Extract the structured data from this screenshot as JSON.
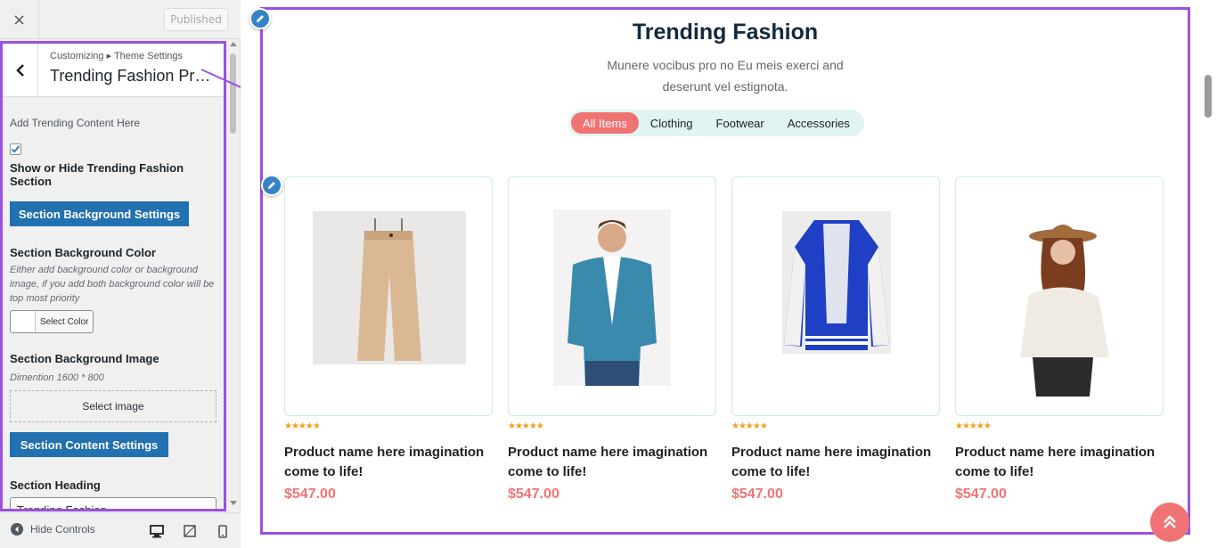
{
  "topbar": {
    "close_icon": "×",
    "publish_label": "Published"
  },
  "panel": {
    "breadcrumb": "Customizing ▸ Theme Settings",
    "title": "Trending Fashion Pro…",
    "add_content_text": "Add Trending Content Here",
    "show_hide_label": "Show or Hide Trending Fashion Section",
    "show_hide_checked": true,
    "bg_settings_button": "Section Background Settings",
    "bg_color_label": "Section Background Color",
    "bg_color_desc": "Either add background color or background image, if you add both background color will be top most priority",
    "select_color_label": "Select Color",
    "bg_image_label": "Section Background Image",
    "bg_image_desc": "Dimention 1600 * 800",
    "select_image_label": "Select image",
    "content_settings_button": "Section Content Settings",
    "heading_label": "Section Heading",
    "heading_value": "Trending Fashion"
  },
  "footer": {
    "hide_controls_label": "Hide Controls"
  },
  "preview": {
    "title": "Trending Fashion",
    "description": "Munere vocibus pro no Eu meis exerci and deserunt vel estignota.",
    "filters": [
      "All Items",
      "Clothing",
      "Footwear",
      "Accessories"
    ],
    "active_filter": "All Items",
    "products": [
      {
        "image": "beige-trousers",
        "name": "Product name here imagination come to life!",
        "price": "$547.00",
        "rating": 5
      },
      {
        "image": "man-denim-shirt",
        "name": "Product name here imagination come to life!",
        "price": "$547.00",
        "rating": 5
      },
      {
        "image": "blue-varsity-jacket",
        "name": "Product name here imagination come to life!",
        "price": "$547.00",
        "rating": 5
      },
      {
        "image": "woman-hat-sweater",
        "name": "Product name here imagination come to life!",
        "price": "$547.00",
        "rating": 5
      }
    ]
  },
  "colors": {
    "accent": "#f07373",
    "wp_blue": "#2271b1",
    "highlight": "#9b51e0",
    "filter_bg": "#e0f5f2"
  }
}
